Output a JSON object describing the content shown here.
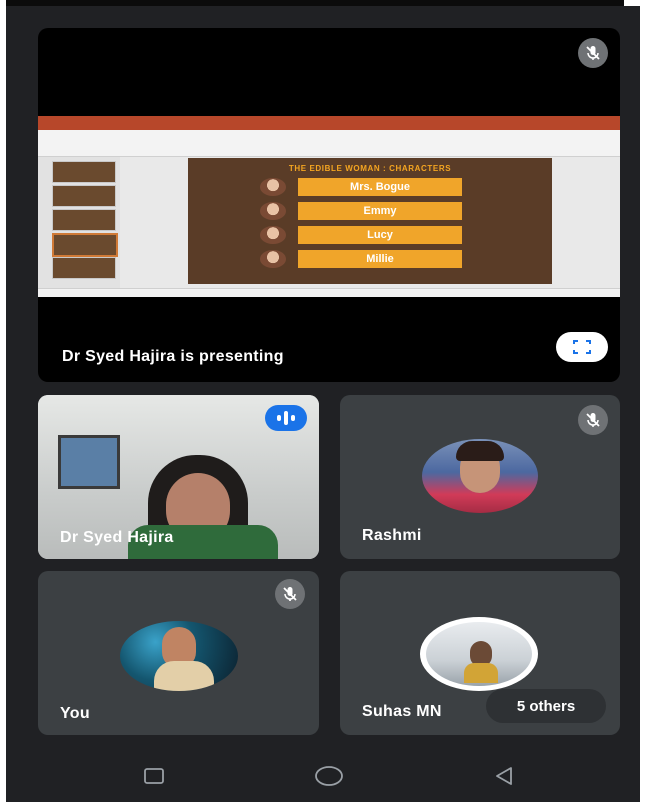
{
  "presentation": {
    "status_text": "Dr Syed Hajira is presenting",
    "slide": {
      "title": "THE EDIBLE WOMAN : CHARACTERS",
      "characters": [
        "Mrs. Bogue",
        "Emmy",
        "Lucy",
        "Millie"
      ]
    },
    "mic_state": "muted",
    "fullscreen_icon": "fullscreen-icon"
  },
  "participants": [
    {
      "name": "Dr Syed Hajira",
      "status": "speaking"
    },
    {
      "name": "Rashmi",
      "status": "muted"
    },
    {
      "name": "You",
      "status": "muted"
    },
    {
      "name": "Suhas MN",
      "status": "unmuted"
    }
  ],
  "others_label": "5 others",
  "navigation": {
    "icons": [
      "recents-icon",
      "home-icon",
      "back-icon"
    ]
  },
  "colors": {
    "background": "#202124",
    "tile": "#3c4043",
    "speaking_accent": "#1a73e8",
    "slide_accent": "#f0a52a"
  }
}
